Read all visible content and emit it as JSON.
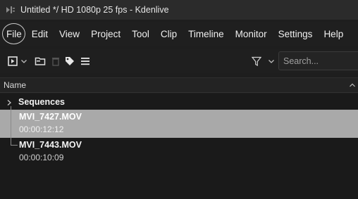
{
  "window": {
    "title": "Untitled */ HD 1080p 25 fps - Kdenlive",
    "app_icon": "kdenlive-icon"
  },
  "menubar": {
    "items": [
      "File",
      "Edit",
      "View",
      "Project",
      "Tool",
      "Clip",
      "Timeline",
      "Monitor",
      "Settings",
      "Help"
    ],
    "highlighted": "File"
  },
  "toolbar": {
    "icons": [
      "add-clip-icon",
      "dropdown-arrow-icon",
      "add-folder-icon",
      "delete-icon",
      "tag-icon",
      "menu-icon",
      "filter-icon",
      "dropdown-arrow-icon"
    ],
    "search": {
      "placeholder": "Search...",
      "value": ""
    }
  },
  "bin": {
    "column_header": "Name",
    "folder": {
      "label": "Sequences",
      "expanded": false
    },
    "clips": [
      {
        "name": "MVI_7427.MOV",
        "duration": "00:00:12:12",
        "selected": true
      },
      {
        "name": "MVI_7443.MOV",
        "duration": "00:00:10:09",
        "selected": false
      }
    ]
  },
  "colors": {
    "selection": "#a9a9a9",
    "background": "#1a1a1a",
    "text": "#f0f0f0"
  }
}
